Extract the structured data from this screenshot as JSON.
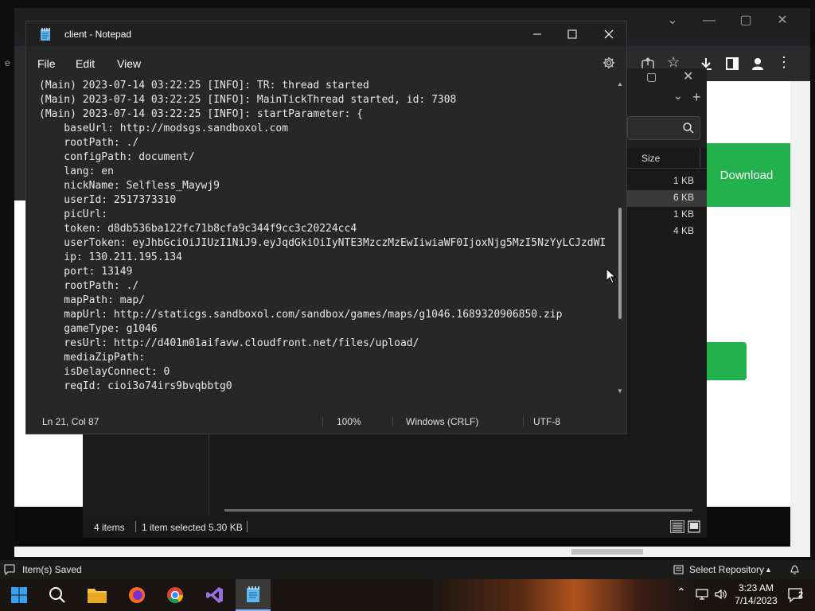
{
  "notepad": {
    "title": "client - Notepad",
    "menu": [
      "File",
      "Edit",
      "View"
    ],
    "lines": [
      "(Main) 2023-07-14 03:22:25 [INFO]: TR: thread started",
      "(Main) 2023-07-14 03:22:25 [INFO]: MainTickThread started, id: 7308",
      "(Main) 2023-07-14 03:22:25 [INFO]: startParameter: {",
      "    baseUrl: http://modsgs.sandboxol.com",
      "    rootPath: ./",
      "    configPath: document/",
      "    lang: en",
      "    nickName: Selfless_Maywj9",
      "    userId: 2517373310",
      "    picUrl:",
      "    token: d8db536ba122fc71b8cfa9c344f9cc3c20224cc4",
      "    userToken: eyJhbGciOiJIUzI1NiJ9.eyJqdGkiOiIyNTE3MzczMzEwIiwiaWF0IjoxNjg5MzI5NzYyLCJzdWI",
      "    ip: 130.211.195.134",
      "    port: 13149",
      "    rootPath: ./",
      "    mapPath: map/",
      "    mapUrl: http://staticgs.sandboxol.com/sandbox/games/maps/g1046.1689320906850.zip",
      "    gameType: g1046",
      "    resUrl: http://d401m01aifavw.cloudfront.net/files/upload/",
      "    mediaZipPath:",
      "    isDelayConnect: 0",
      "    reqId: cioi3o74irs9bvqbbtg0"
    ],
    "status": {
      "position": "Ln 21, Col 87",
      "zoom": "100%",
      "line_ending": "Windows (CRLF)",
      "encoding": "UTF-8"
    }
  },
  "explorer": {
    "column_size": "Size",
    "sizes": [
      "1 KB",
      "6 KB",
      "1 KB",
      "4 KB"
    ],
    "status_items": "4 items",
    "status_selected": "1 item selected",
    "status_size": "5.30 KB"
  },
  "browser": {
    "download_label": "Download"
  },
  "vs_status": {
    "left": "Item(s) Saved",
    "right": "Select Repository"
  },
  "taskbar": {
    "time": "3:23 AM",
    "date": "7/14/2023",
    "notification_count": "2"
  },
  "colors": {
    "accent_green": "#23b14d",
    "notepad_bg": "#272727"
  }
}
